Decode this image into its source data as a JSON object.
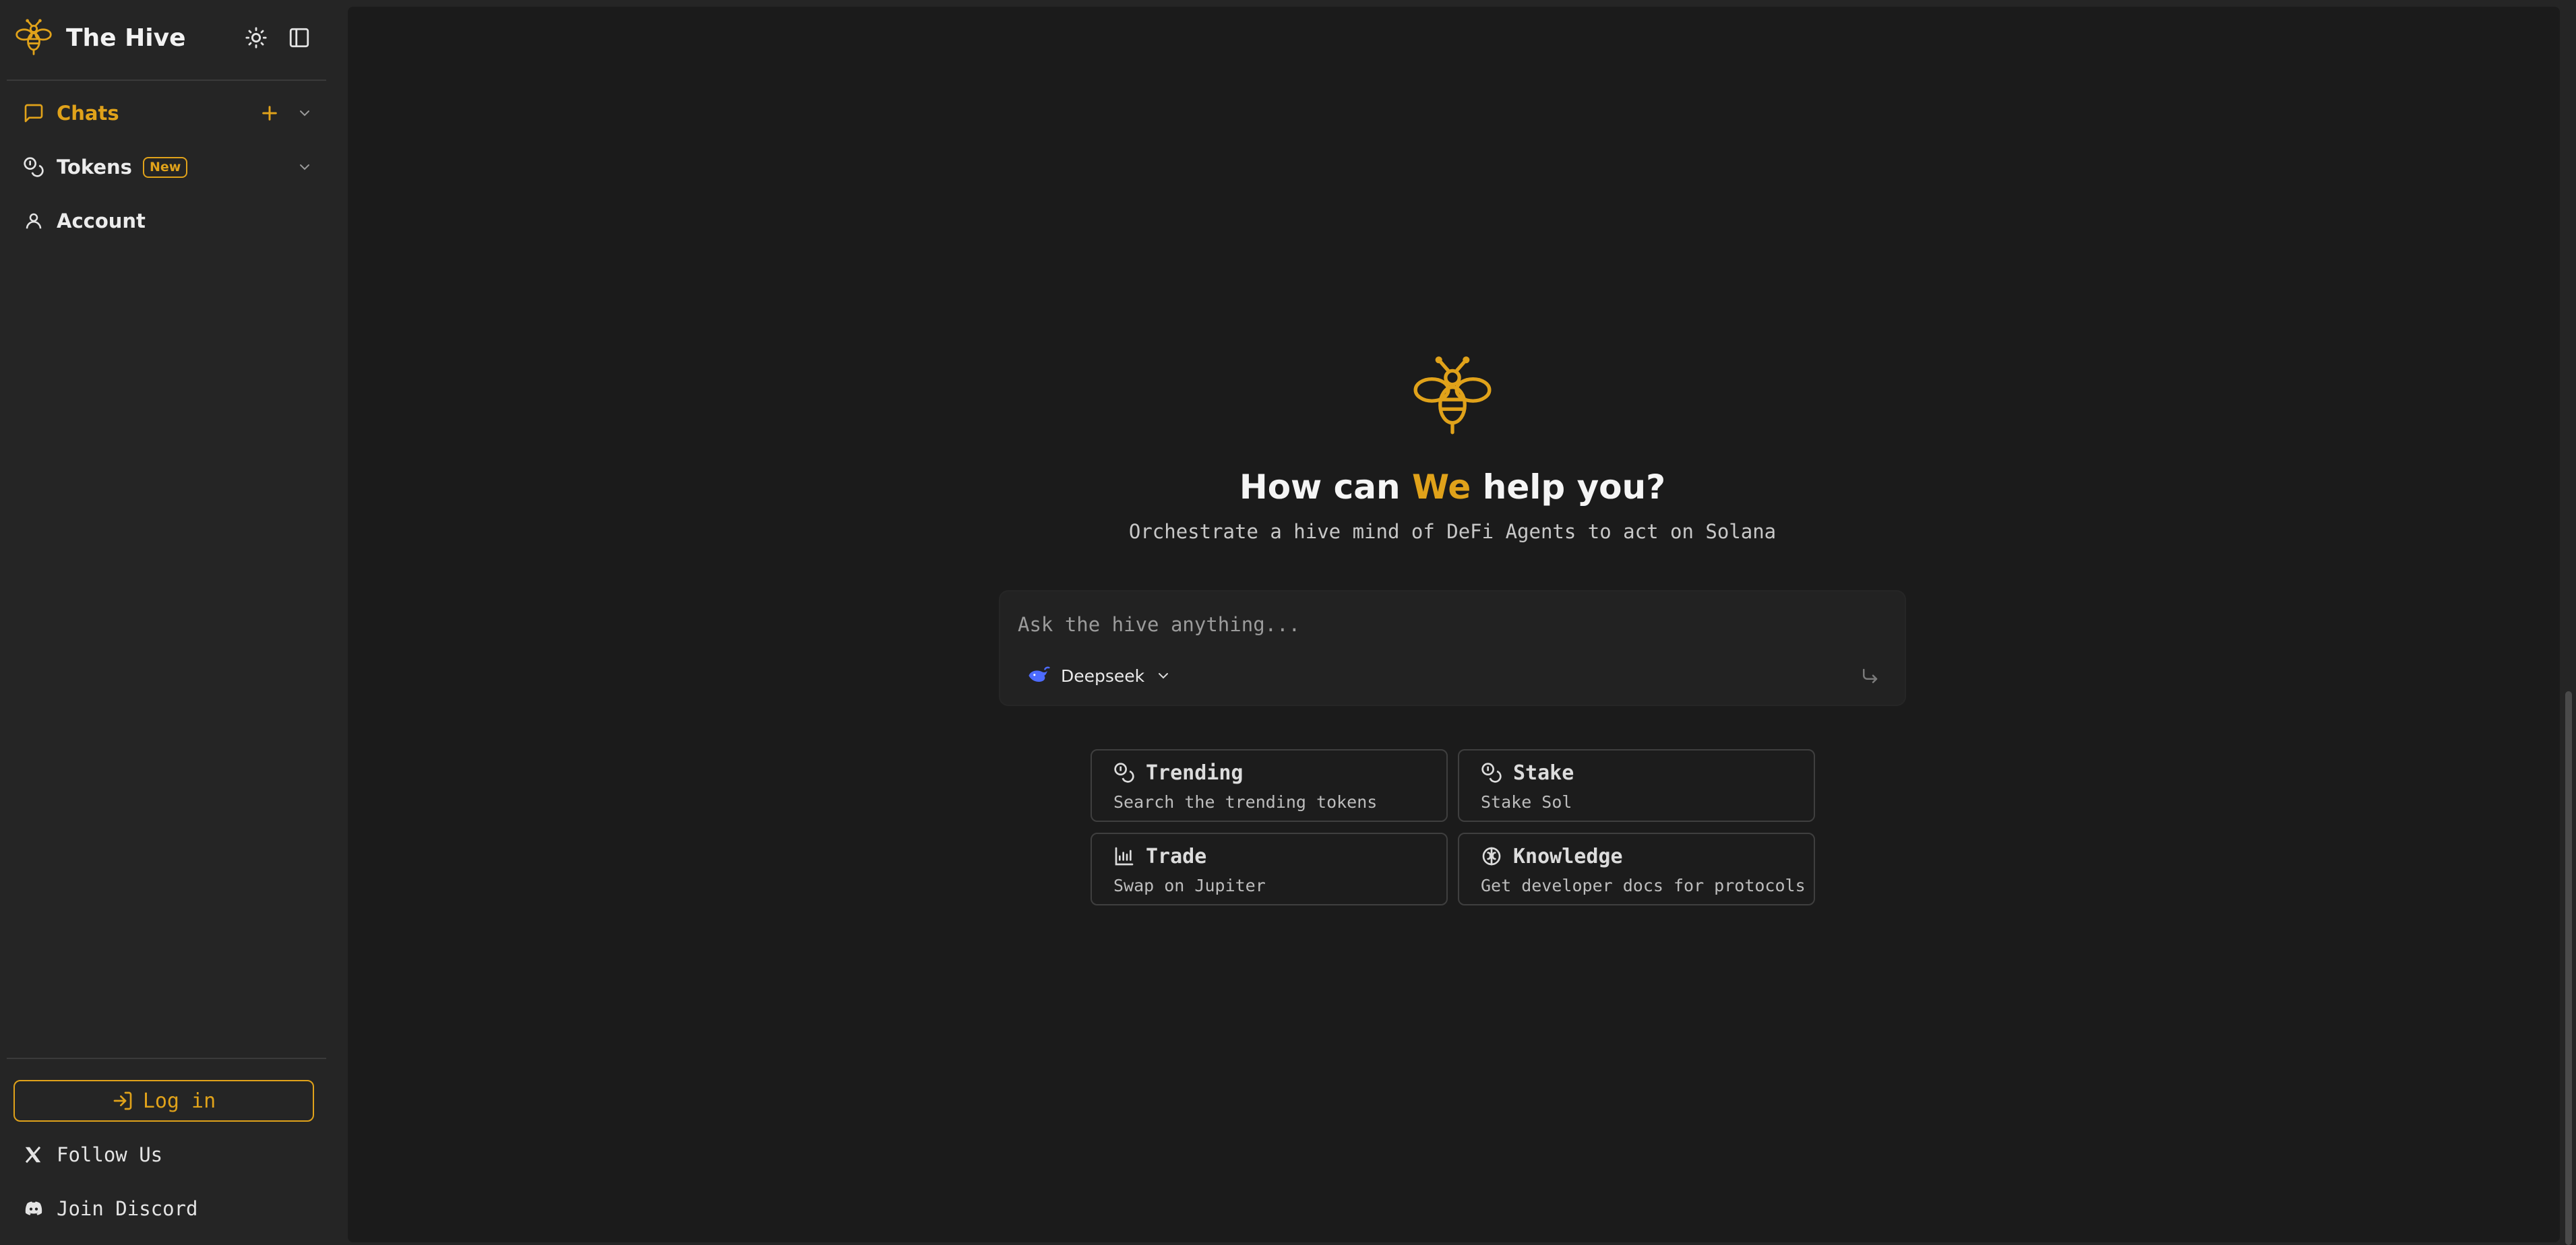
{
  "app": {
    "title": "The Hive"
  },
  "colors": {
    "accent": "#e0a21a",
    "sidebar_bg": "#252525",
    "main_bg": "#1b1b1b"
  },
  "sidebar": {
    "nav": [
      {
        "label": "Chats",
        "icon": "chat-bubble-icon",
        "active": true
      },
      {
        "label": "Tokens",
        "icon": "coins-icon",
        "badge": "New"
      },
      {
        "label": "Account",
        "icon": "user-icon"
      }
    ],
    "login_label": "Log in",
    "footer_links": [
      {
        "label": "Follow Us",
        "icon": "x-logo-icon"
      },
      {
        "label": "Join Discord",
        "icon": "discord-icon"
      }
    ]
  },
  "main": {
    "headline_pre": "How can ",
    "headline_accent": "We",
    "headline_post": " help you?",
    "subtitle": "Orchestrate a hive mind of DeFi Agents to act on Solana",
    "input_placeholder": "Ask the hive anything...",
    "model": {
      "label": "Deepseek",
      "icon": "deepseek-whale-icon"
    },
    "suggestions": [
      {
        "title": "Trending",
        "description": "Search the trending tokens",
        "icon": "coins-icon"
      },
      {
        "title": "Stake",
        "description": "Stake Sol",
        "icon": "coins-icon"
      },
      {
        "title": "Trade",
        "description": "Swap on Jupiter",
        "icon": "chart-icon"
      },
      {
        "title": "Knowledge",
        "description": "Get developer docs for protocols",
        "icon": "brain-icon"
      }
    ]
  }
}
